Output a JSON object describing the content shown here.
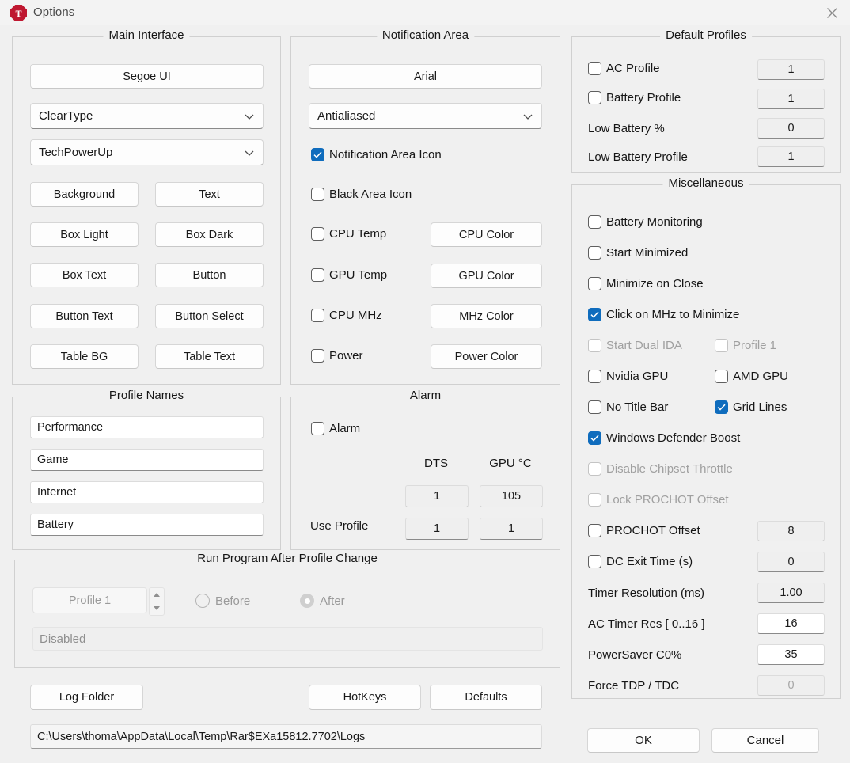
{
  "window": {
    "title": "Options",
    "icon": "throttlestop-icon",
    "icon_letter": "T",
    "close_icon": "close-icon",
    "accent_checked": "#0f6cbd",
    "icon_color": "#bf1730",
    "background": "#f0f0f0"
  },
  "main_interface": {
    "legend": "Main Interface",
    "font_button": "Segoe UI",
    "render_combo": "ClearType",
    "theme_combo": "TechPowerUp",
    "color_buttons": [
      "Background",
      "Text",
      "Box Light",
      "Box Dark",
      "Box Text",
      "Button",
      "Button Text",
      "Button Select",
      "Table BG",
      "Table Text"
    ]
  },
  "notification_area": {
    "legend": "Notification Area",
    "font_button": "Arial",
    "render_combo": "Antialiased",
    "checks": [
      {
        "label": "Notification Area Icon",
        "checked": true
      },
      {
        "label": "Black Area Icon",
        "checked": false
      },
      {
        "label": "CPU Temp",
        "checked": false
      },
      {
        "label": "GPU Temp",
        "checked": false
      },
      {
        "label": "CPU MHz",
        "checked": false
      },
      {
        "label": "Power",
        "checked": false
      }
    ],
    "color_buttons": [
      "CPU Color",
      "GPU Color",
      "MHz Color",
      "Power Color"
    ]
  },
  "profile_names": {
    "legend": "Profile Names",
    "values": [
      "Performance",
      "Game",
      "Internet",
      "Battery"
    ]
  },
  "alarm": {
    "legend": "Alarm",
    "enable": {
      "label": "Alarm",
      "checked": false
    },
    "columns": [
      "DTS",
      "GPU °C"
    ],
    "threshold_row": [
      "1",
      "105"
    ],
    "use_profile_label": "Use Profile",
    "use_profile_row": [
      "1",
      "1"
    ]
  },
  "run_program": {
    "legend": "Run Program After Profile Change",
    "profile_spinner": "Profile 1",
    "radios": [
      {
        "label": "Before",
        "selected": false
      },
      {
        "label": "After",
        "selected": true
      }
    ],
    "program_path": "Disabled"
  },
  "default_profiles": {
    "legend": "Default Profiles",
    "rows": [
      {
        "type": "checkbox",
        "label": "AC Profile",
        "checked": false,
        "value": "1"
      },
      {
        "type": "checkbox",
        "label": "Battery Profile",
        "checked": false,
        "value": "1"
      },
      {
        "type": "label",
        "label": "Low Battery %",
        "value": "0"
      },
      {
        "type": "label",
        "label": "Low Battery Profile",
        "value": "1"
      }
    ]
  },
  "miscellaneous": {
    "legend": "Miscellaneous",
    "checks": [
      {
        "label": "Battery Monitoring",
        "checked": false,
        "disabled": false
      },
      {
        "label": "Start Minimized",
        "checked": false,
        "disabled": false
      },
      {
        "label": "Minimize on Close",
        "checked": false,
        "disabled": false
      },
      {
        "label": "Click on MHz to Minimize",
        "checked": true,
        "disabled": false
      },
      {
        "label": "Start Dual IDA",
        "checked": false,
        "disabled": true
      },
      {
        "label": "Profile 1",
        "checked": false,
        "disabled": true
      },
      {
        "label": "Nvidia GPU",
        "checked": false,
        "disabled": false
      },
      {
        "label": "AMD GPU",
        "checked": false,
        "disabled": false
      },
      {
        "label": "No Title Bar",
        "checked": false,
        "disabled": false
      },
      {
        "label": "Grid Lines",
        "checked": true,
        "disabled": false
      },
      {
        "label": "Windows Defender Boost",
        "checked": true,
        "disabled": false
      },
      {
        "label": "Disable Chipset Throttle",
        "checked": false,
        "disabled": true
      },
      {
        "label": "Lock PROCHOT Offset",
        "checked": false,
        "disabled": true
      }
    ],
    "value_rows": [
      {
        "type": "checkbox",
        "label": "PROCHOT Offset",
        "checked": false,
        "value": "8",
        "field": "gray"
      },
      {
        "type": "checkbox",
        "label": "DC Exit Time (s)",
        "checked": false,
        "value": "0",
        "field": "gray"
      },
      {
        "type": "label",
        "label": "Timer Resolution (ms)",
        "value": "1.00",
        "field": "gray"
      },
      {
        "type": "label",
        "label": "AC Timer Res [ 0..16 ]",
        "value": "16",
        "field": "white"
      },
      {
        "type": "label",
        "label": "PowerSaver C0%",
        "value": "35",
        "field": "white"
      },
      {
        "type": "label",
        "label": "Force TDP / TDC",
        "value": "0",
        "field": "disabled"
      }
    ]
  },
  "footer": {
    "log_folder_button": "Log Folder",
    "hotkeys_button": "HotKeys",
    "defaults_button": "Defaults",
    "log_path": "C:\\Users\\thoma\\AppData\\Local\\Temp\\Rar$EXa15812.7702\\Logs",
    "ok_button": "OK",
    "cancel_button": "Cancel"
  }
}
